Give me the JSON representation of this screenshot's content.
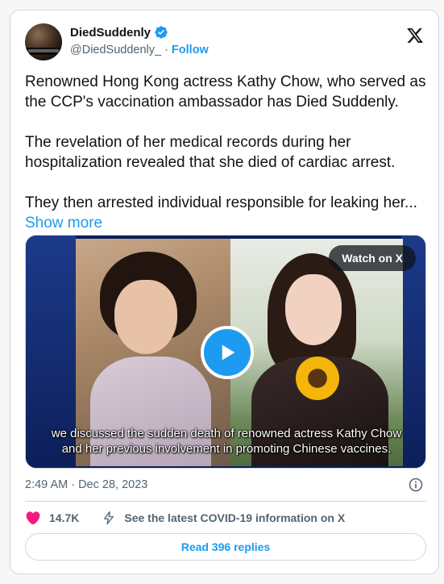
{
  "author": {
    "name": "DiedSuddenly",
    "handle": "@DiedSuddenly_",
    "separator": "·",
    "follow_label": "Follow",
    "verified_icon": "verified-badge-icon",
    "avatar_icon": "avatar"
  },
  "tweet": {
    "paragraphs": [
      "Renowned Hong Kong actress Kathy Chow, who served as the CCP's vaccination ambassador has Died Suddenly.",
      "The revelation of her medical records during her hospitalization revealed that she died of cardiac arrest.",
      "They then arrested individual responsible for leaking her..."
    ],
    "show_more_label": "Show more"
  },
  "media": {
    "watch_label": "Watch on X",
    "caption_line1": "we discussed the sudden death of renowned actress Kathy Chow",
    "caption_line2": "and her previous involvement in promoting Chinese vaccines."
  },
  "meta": {
    "timestamp": "2:49 AM · Dec 28, 2023"
  },
  "actions": {
    "like_count": "14.7K",
    "covid_link": "See the latest COVID-19 information on X",
    "read_replies": "Read 396 replies"
  },
  "colors": {
    "accent": "#1d9bf0",
    "like": "#f91880",
    "muted": "#536471",
    "text": "#0f1419",
    "border": "#cfd9de"
  }
}
